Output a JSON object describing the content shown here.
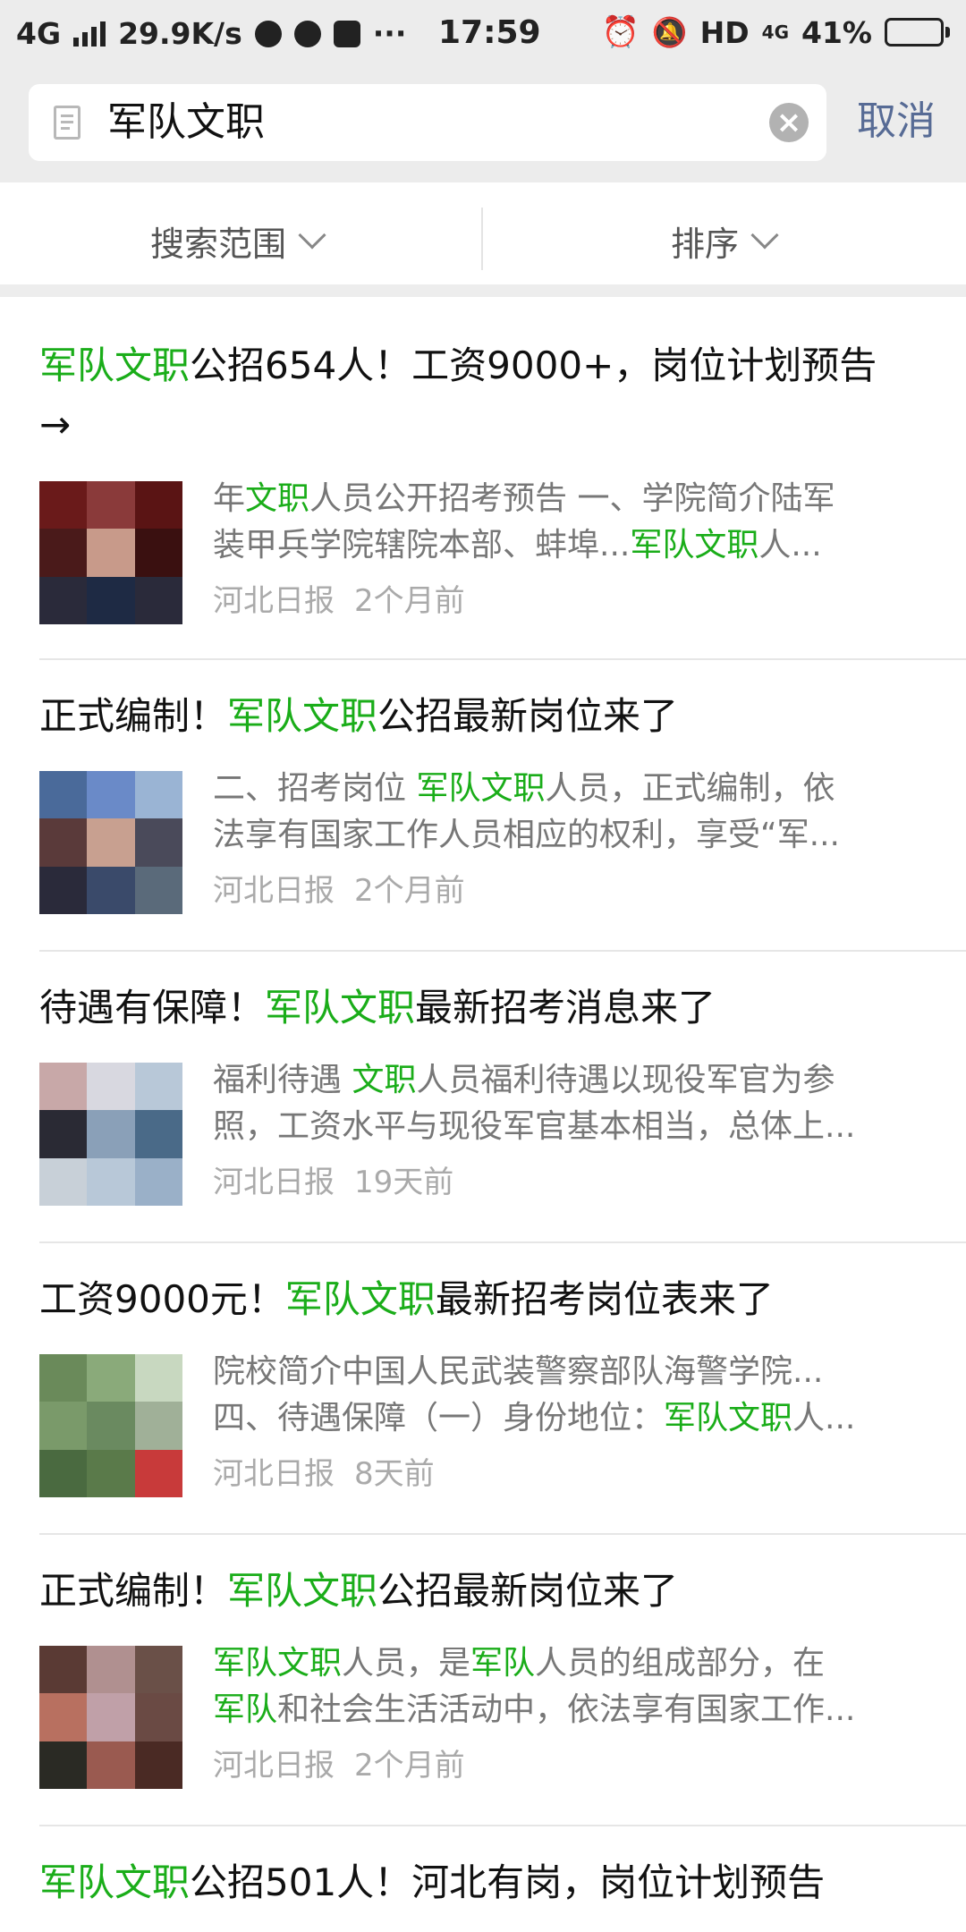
{
  "status_bar": {
    "network": "4G",
    "speed": "29.9K/s",
    "more": "···",
    "time": "17:59",
    "hd": "HD",
    "net_right": "4G",
    "battery": "41%",
    "battery_level": 0.41
  },
  "search": {
    "query": "军队文职",
    "cancel_label": "取消"
  },
  "filters": {
    "scope_label": "搜索范围",
    "sort_label": "排序"
  },
  "results": [
    {
      "title": [
        {
          "t": "军队文职",
          "h": true
        },
        {
          "t": "公招654人！工资9000+，岗位计划预告"
        }
      ],
      "title2": [
        {
          "t": "→"
        }
      ],
      "line1": [
        {
          "t": "年"
        },
        {
          "t": "文职",
          "h": true
        },
        {
          "t": "人员公开招考预告 一、学院简介陆军"
        }
      ],
      "line2": [
        {
          "t": "装甲兵学院辖院本部、蚌埠..."
        },
        {
          "t": "军队文职",
          "h": true
        },
        {
          "t": "人..."
        }
      ],
      "source": "河北日报",
      "time": "2个月前"
    },
    {
      "title": [
        {
          "t": "正式编制！"
        },
        {
          "t": "军队文职",
          "h": true
        },
        {
          "t": "公招最新岗位来了"
        }
      ],
      "line1": [
        {
          "t": "二、招考岗位 "
        },
        {
          "t": "军队文职",
          "h": true
        },
        {
          "t": "人员，正式编制，依"
        }
      ],
      "line2": [
        {
          "t": "法享有国家工作人员相应的权利，享受“军..."
        }
      ],
      "source": "河北日报",
      "time": "2个月前"
    },
    {
      "title": [
        {
          "t": "待遇有保障！"
        },
        {
          "t": "军队文职",
          "h": true
        },
        {
          "t": "最新招考消息来了"
        }
      ],
      "line1": [
        {
          "t": "福利待遇 "
        },
        {
          "t": "文职",
          "h": true
        },
        {
          "t": "人员福利待遇以现役军官为参"
        }
      ],
      "line2": [
        {
          "t": "照，工资水平与现役军官基本相当，总体上..."
        }
      ],
      "source": "河北日报",
      "time": "19天前"
    },
    {
      "title": [
        {
          "t": "工资9000元！"
        },
        {
          "t": "军队文职",
          "h": true
        },
        {
          "t": "最新招考岗位表来了"
        }
      ],
      "line1": [
        {
          "t": "院校简介中国人民武装警察部队海警学院..."
        }
      ],
      "line2": [
        {
          "t": "四、待遇保障（一）身份地位："
        },
        {
          "t": "军队文职",
          "h": true
        },
        {
          "t": "人..."
        }
      ],
      "source": "河北日报",
      "time": "8天前"
    },
    {
      "title": [
        {
          "t": "正式编制！"
        },
        {
          "t": "军队文职",
          "h": true
        },
        {
          "t": "公招最新岗位来了"
        }
      ],
      "line1": [
        {
          "t": "军队文职",
          "h": true
        },
        {
          "t": "人员，是"
        },
        {
          "t": "军队",
          "h": true
        },
        {
          "t": "人员的组成部分，在"
        }
      ],
      "line2": [
        {
          "t": "军队",
          "h": true
        },
        {
          "t": "和社会生活活动中，依法享有国家工作..."
        }
      ],
      "source": "河北日报",
      "time": "2个月前"
    },
    {
      "title": [
        {
          "t": "军队文职",
          "h": true
        },
        {
          "t": "公招501人！河北有岗，岗位计划预告"
        }
      ]
    }
  ],
  "colors": {
    "highlight": "#1aad19",
    "cancel": "#576b95"
  }
}
